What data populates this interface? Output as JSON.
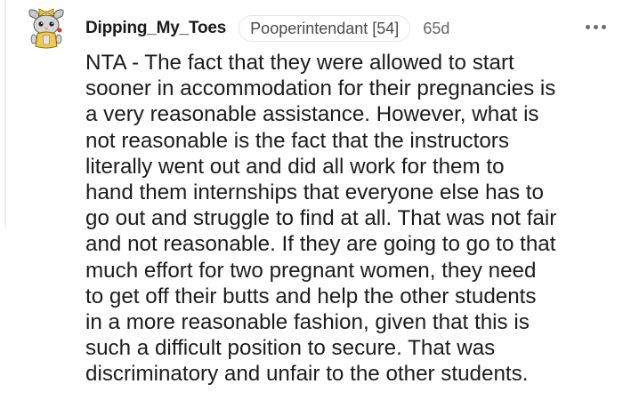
{
  "comment": {
    "username": "Dipping_My_Toes",
    "flair": "Pooperintendant [54]",
    "age": "65d",
    "more_icon": "more-horizontal-icon",
    "avatar_icon": "snoo-avatar-icon",
    "body_lines": [
      "NTA - The fact that they were allowed to start",
      "sooner in accommodation for their pregnancies is",
      "a very reasonable assistance. However, what is",
      "not reasonable is the fact that the instructors",
      "literally went out and did all work for them to",
      "hand them internships that everyone else has to",
      "go out and struggle to find at all. That was not fair",
      "and not reasonable. If they are going to go to that",
      "much effort for two pregnant women, they need",
      "to get off their butts and help the other students",
      "in a more reasonable fashion, given that this is",
      "such a difficult position to secure. That was",
      "discriminatory and unfair to the other students."
    ]
  },
  "colors": {
    "text": "#1c1c1c",
    "meta": "#666666",
    "flair_border": "#e6e6e6",
    "thread_line": "#edeff1"
  }
}
